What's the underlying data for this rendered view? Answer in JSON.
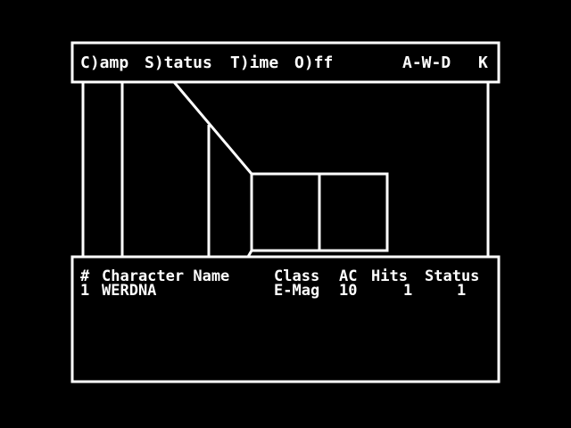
{
  "command_menu": {
    "camp": "C)amp",
    "status": "S)tatus",
    "time": "T)ime",
    "off": "O)ff",
    "movement_keys": "A-W-D",
    "kick_key": "K"
  },
  "party_roster": {
    "headers": {
      "number": "#",
      "name": "Character Name",
      "class": "Class",
      "ac": "AC",
      "hits": "Hits",
      "status": "Status"
    },
    "characters": [
      {
        "number": "1",
        "name": "WERDNA",
        "class": "E-Mag",
        "ac": "10",
        "hits": "1",
        "status": "1"
      }
    ]
  },
  "colors": {
    "background": "#000000",
    "foreground": "#ffffff"
  }
}
